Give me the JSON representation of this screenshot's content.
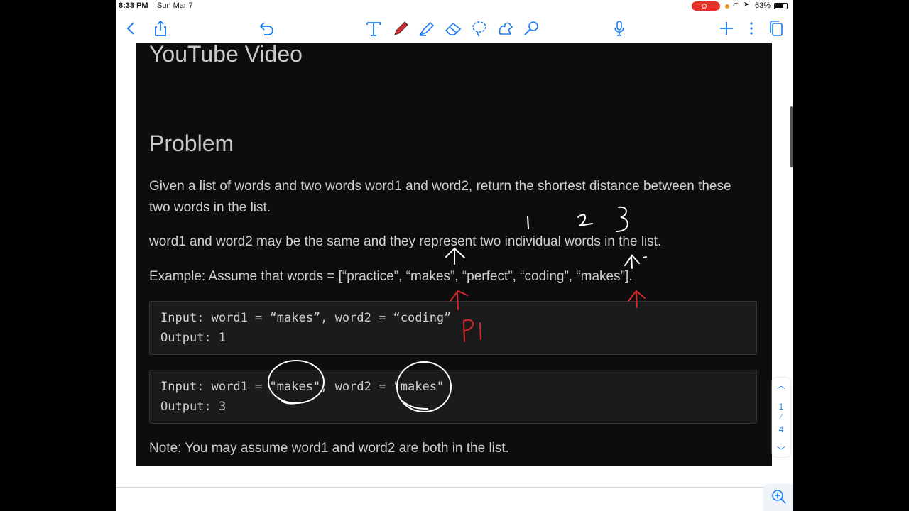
{
  "status": {
    "time": "8:33 PM",
    "date": "Sun Mar 7",
    "battery": "63%"
  },
  "toolbar": {
    "left_icons": [
      "back-icon",
      "share-icon",
      "undo-icon"
    ],
    "tools": [
      "text-tool-icon",
      "pen-tool-icon",
      "highlighter-icon",
      "eraser-icon",
      "lasso-icon",
      "shapes-icon",
      "laser-pointer-icon"
    ],
    "right_icons": [
      "microphone-icon",
      "add-page-icon",
      "more-icon",
      "pages-icon"
    ]
  },
  "doc": {
    "video_heading": "YouTube Video",
    "problem_heading": "Problem",
    "para1": "Given a list of words and two words word1 and word2, return the shortest distance between these two words in the list.",
    "para2": "word1 and word2 may be the same and they represent two individual words in the list.",
    "para3": "Example: Assume that words = [“practice”, “makes”, “perfect”, “coding”, “makes”].",
    "code1": {
      "line1": "Input: word1 = “makes”, word2 = “coding”",
      "line2": "Output: 1"
    },
    "code2": {
      "line1": "Input: word1 = \"makes\", word2 = \"makes\"",
      "line2": "Output: 3"
    },
    "note": "Note: You may assume word1 and word2 are both in the list."
  },
  "annotations": {
    "numbers": [
      "1",
      "2",
      "3"
    ],
    "pointer_label": "P1",
    "ink_color": "#d8262c"
  },
  "pager": {
    "current": "1",
    "total": "4"
  }
}
